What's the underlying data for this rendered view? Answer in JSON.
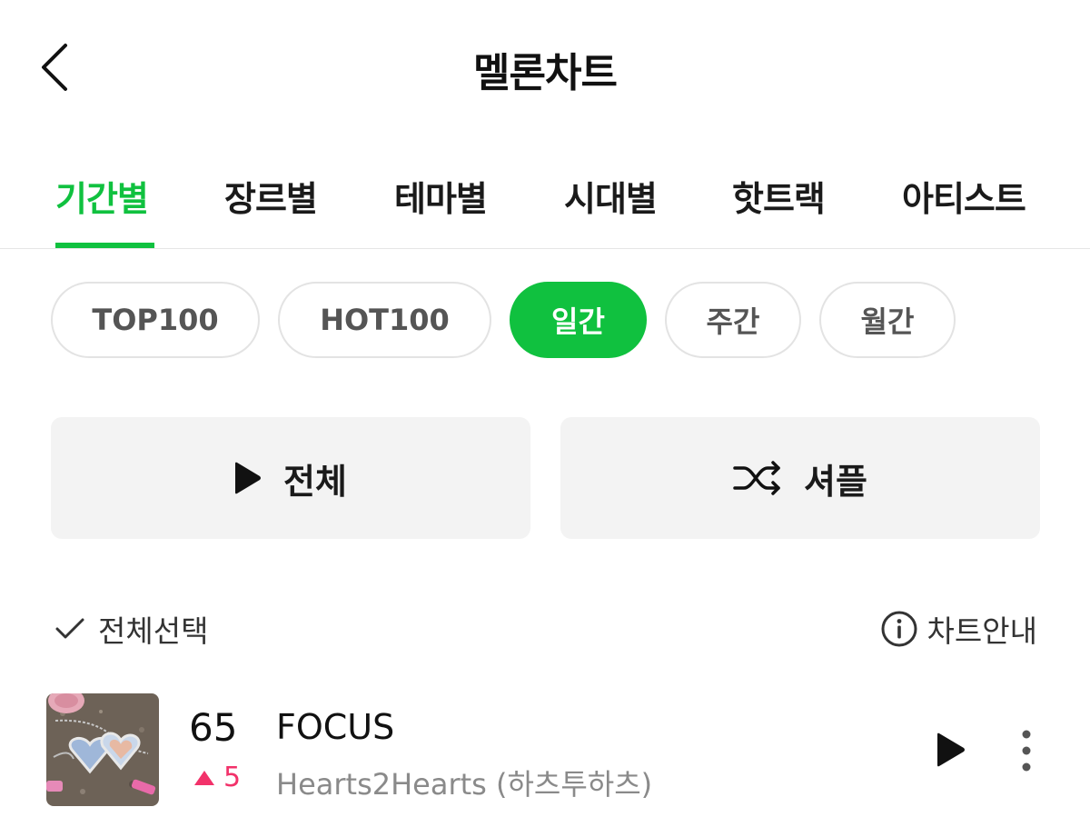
{
  "header": {
    "title": "멜론차트",
    "back_icon": "chevron-left-icon"
  },
  "tabs": [
    {
      "label": "기간별",
      "active": true
    },
    {
      "label": "장르별",
      "active": false
    },
    {
      "label": "테마별",
      "active": false
    },
    {
      "label": "시대별",
      "active": false
    },
    {
      "label": "핫트랙",
      "active": false
    },
    {
      "label": "아티스트",
      "active": false
    }
  ],
  "chips": [
    {
      "label": "TOP100",
      "active": false
    },
    {
      "label": "HOT100",
      "active": false
    },
    {
      "label": "일간",
      "active": true
    },
    {
      "label": "주간",
      "active": false
    },
    {
      "label": "월간",
      "active": false
    }
  ],
  "actions": {
    "play_all_label": "전체",
    "play_all_icon": "play-icon",
    "shuffle_label": "셔플",
    "shuffle_icon": "shuffle-icon"
  },
  "list_toolbar": {
    "select_all_label": "전체선택",
    "select_all_icon": "check-icon",
    "chart_guide_label": "차트안내",
    "chart_guide_icon": "info-icon"
  },
  "songs": [
    {
      "rank": "65",
      "rank_change": "5",
      "rank_direction": "up",
      "title": "FOCUS",
      "artist": "Hearts2Hearts (하츠투하츠)",
      "album_art_icon": "album-art-image"
    }
  ],
  "colors": {
    "accent": "#10c13f",
    "rank_up": "#f2326a",
    "chip_border": "#e3e3e3",
    "button_bg": "#f3f3f3"
  }
}
